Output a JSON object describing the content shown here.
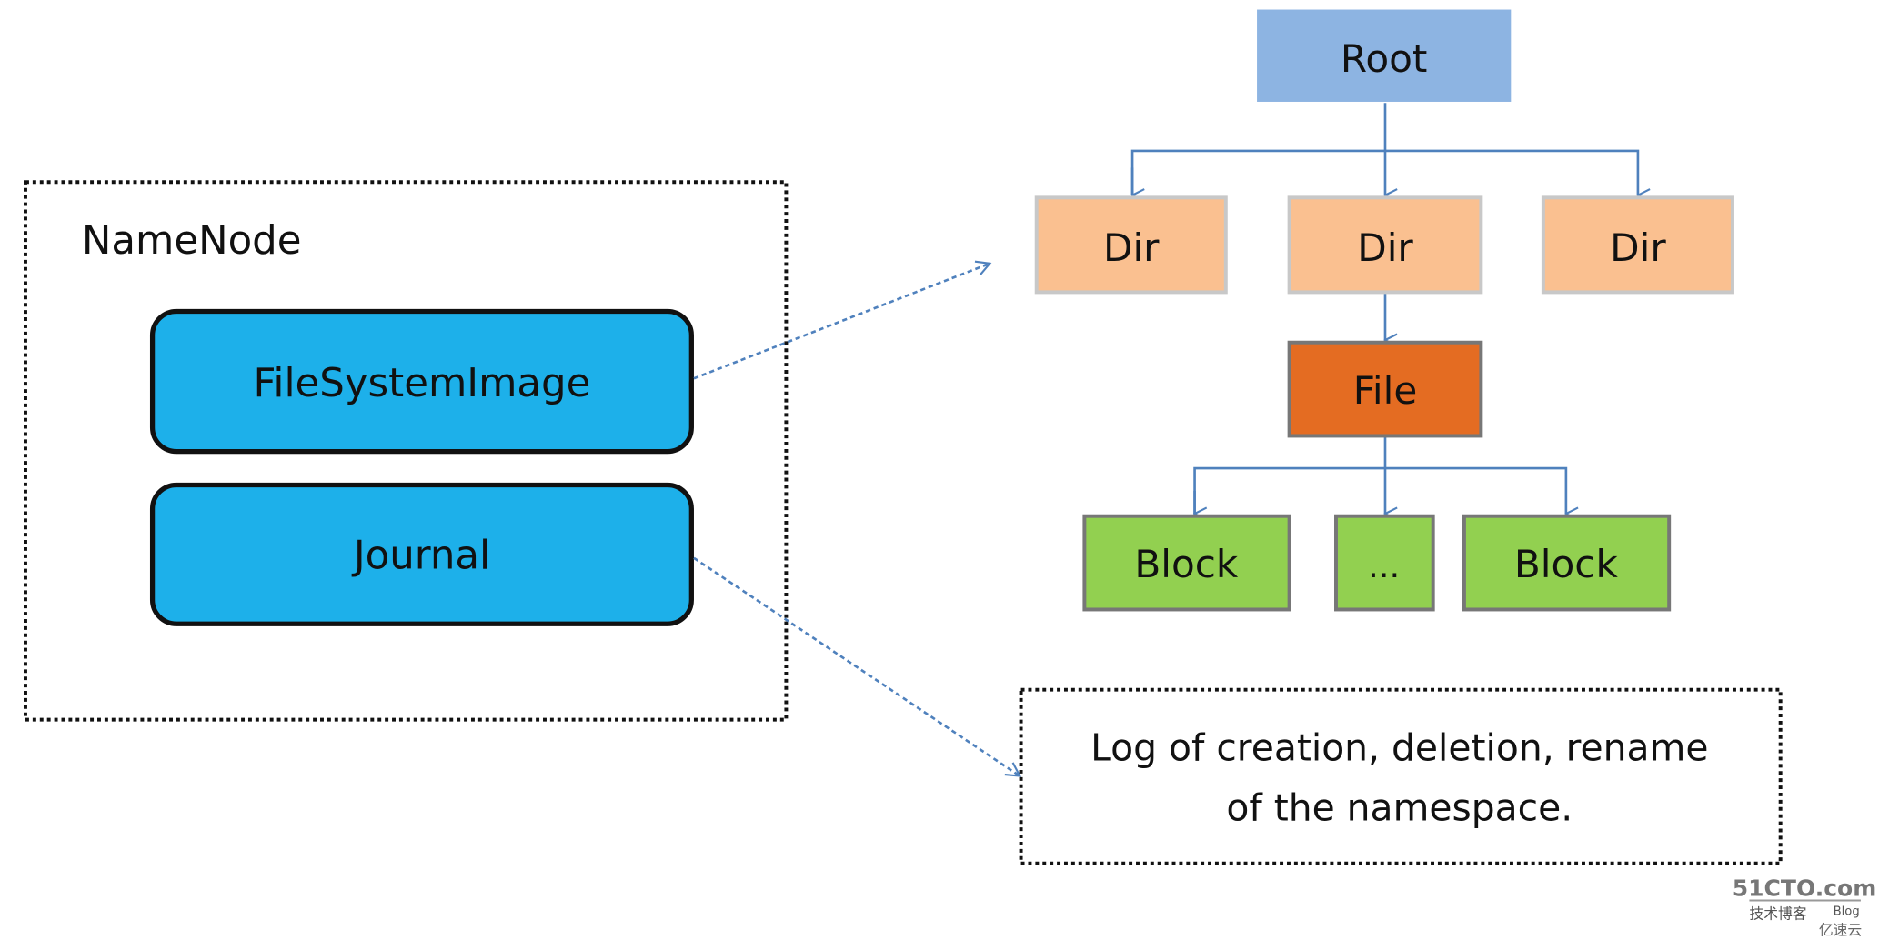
{
  "namenode": {
    "title": "NameNode",
    "components": [
      "FileSystemImage",
      "Journal"
    ]
  },
  "tree": {
    "root": "Root",
    "dirs": [
      "Dir",
      "Dir",
      "Dir"
    ],
    "file": "File",
    "blocks": [
      "Block",
      "...",
      "Block"
    ]
  },
  "journal_note": {
    "line1": "Log of creation, deletion, rename",
    "line2": "of the namespace."
  },
  "watermark": {
    "brand": "51CTO.com",
    "sub": "技术博客",
    "blog": "Blog",
    "partner": "亿速云"
  },
  "colors": {
    "component": "#1db0ea",
    "root": "#8db4e2",
    "dir": "#fac090",
    "file": "#e46c22",
    "block": "#92d050",
    "connector": "#4f81bd"
  }
}
